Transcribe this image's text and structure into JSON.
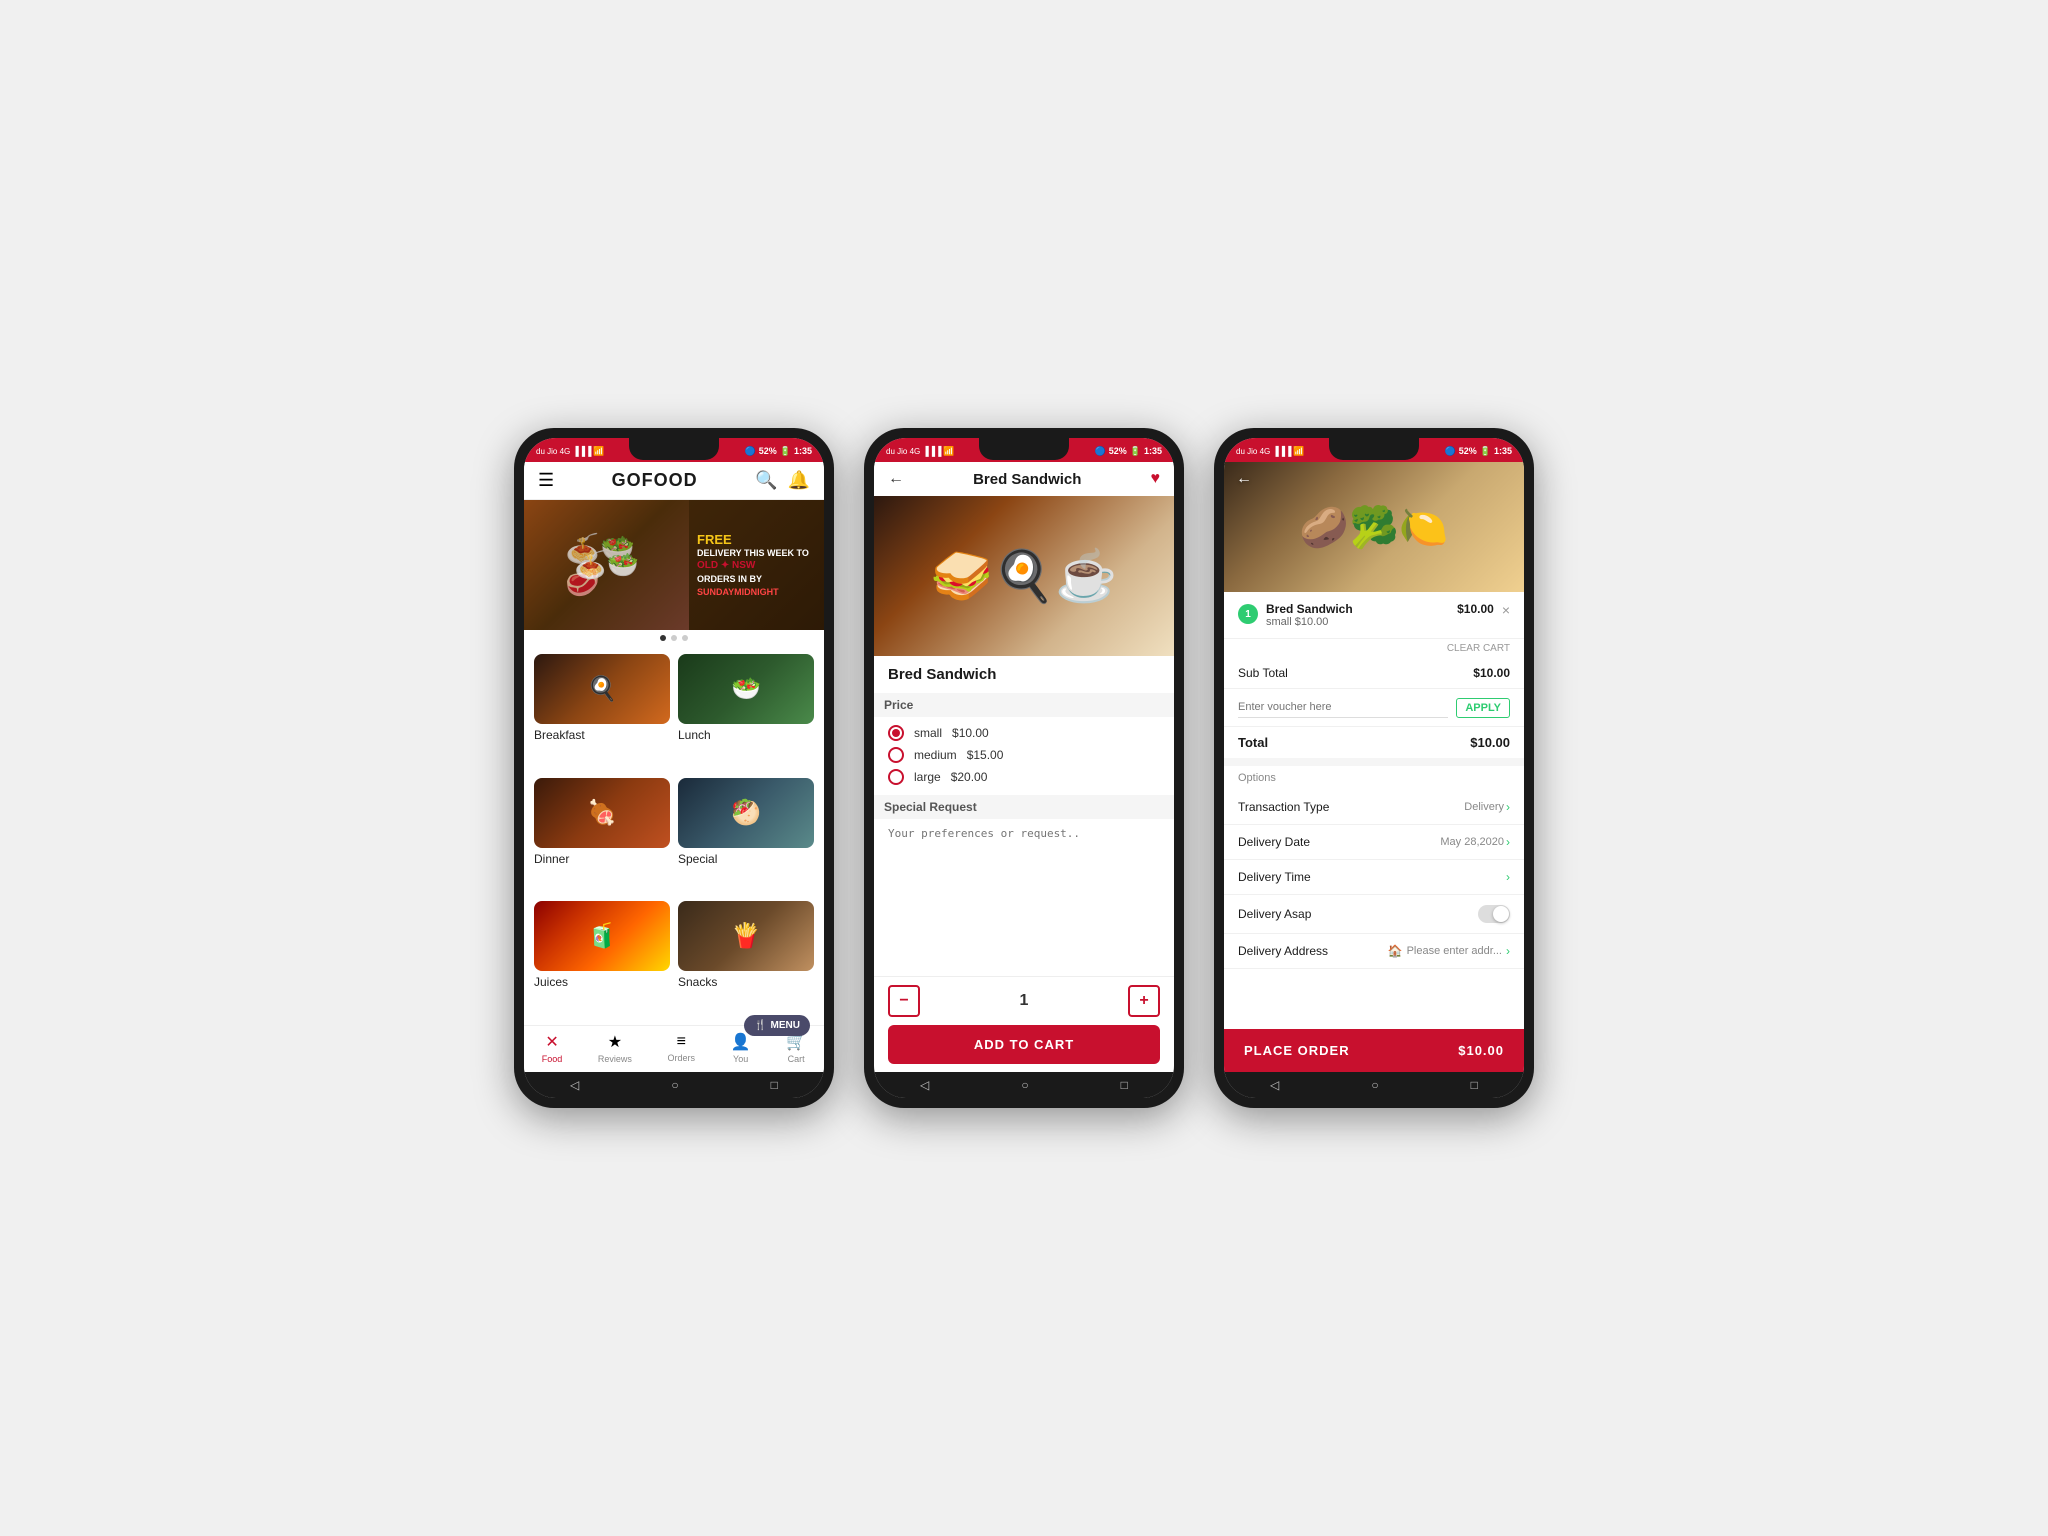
{
  "app": {
    "name": "GOFOOD",
    "time": "1:35",
    "battery": "52%",
    "signal": "4G"
  },
  "phone1": {
    "header": {
      "logo": "GOFOOD",
      "search_icon": "🔍",
      "bell_icon": "🔔"
    },
    "banner": {
      "free_text": "FREE",
      "delivery_text": "DELIVERY THIS WEEK TO",
      "highlight_text": "OLD ✦ NSW",
      "deadline_text": "ORDERS IN BY",
      "deadline_highlight": "SUNDAYMIDNIGHT"
    },
    "categories": [
      {
        "label": "Breakfast",
        "emoji": "🍳"
      },
      {
        "label": "Lunch",
        "emoji": "🥗"
      },
      {
        "label": "Dinner",
        "emoji": "🍖"
      },
      {
        "label": "Special",
        "emoji": "🥙"
      },
      {
        "label": "Juices",
        "emoji": "🧃"
      },
      {
        "label": "Snacks",
        "emoji": "🍟"
      }
    ],
    "menu_float": "MENU",
    "nav": [
      {
        "label": "Food",
        "icon": "✕",
        "active": true
      },
      {
        "label": "Reviews",
        "icon": "★"
      },
      {
        "label": "Orders",
        "icon": "≡"
      },
      {
        "label": "You",
        "icon": "👤"
      },
      {
        "label": "Cart",
        "icon": "🛒"
      }
    ]
  },
  "phone2": {
    "header": {
      "back_icon": "←",
      "title": "Bred Sandwich",
      "heart_icon": "♥"
    },
    "product": {
      "name": "Bred Sandwich",
      "price_section_label": "Price",
      "options": [
        {
          "size": "small",
          "price": "$10.00",
          "selected": true
        },
        {
          "size": "medium",
          "price": "$15.00",
          "selected": false
        },
        {
          "size": "large",
          "price": "$20.00",
          "selected": false
        }
      ],
      "special_request_label": "Special Request",
      "special_request_placeholder": "Your preferences or request.."
    },
    "quantity": {
      "minus": "−",
      "value": "1",
      "plus": "+"
    },
    "add_to_cart_label": "ADD TO CART"
  },
  "phone3": {
    "back_icon": "←",
    "cart": {
      "item_badge": "1",
      "item_name": "Bred Sandwich",
      "item_size": "small $10.00",
      "item_price": "$10.00",
      "close_icon": "×",
      "clear_cart_label": "CLEAR CART"
    },
    "subtotal_label": "Sub Total",
    "subtotal_value": "$10.00",
    "voucher_placeholder": "Enter voucher here",
    "apply_label": "APPLY",
    "total_label": "Total",
    "total_value": "$10.00",
    "options_title": "Options",
    "transaction_type_label": "Transaction Type",
    "transaction_type_value": "Delivery",
    "delivery_date_label": "Delivery Date",
    "delivery_date_value": "May 28,2020",
    "delivery_time_label": "Delivery Time",
    "delivery_time_value": "",
    "delivery_asap_label": "Delivery Asap",
    "delivery_address_label": "Delivery Address",
    "delivery_address_value": "Please enter addr...",
    "place_order_label": "PLACE ORDER",
    "place_order_price": "$10.00"
  }
}
